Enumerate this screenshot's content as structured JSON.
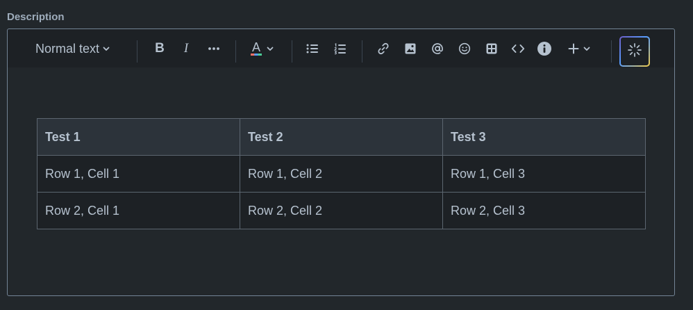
{
  "field": {
    "label": "Description"
  },
  "toolbar": {
    "text_style": "Normal text",
    "bold": "B",
    "italic": "I",
    "text_color": "A",
    "icons": {
      "text_style_chevron": "chevron-down-icon",
      "more_formatting": "more-icon",
      "bullet_list": "bullet-list-icon",
      "numbered_list": "numbered-list-icon",
      "link": "link-icon",
      "image": "image-icon",
      "mention": "mention-icon",
      "emoji": "emoji-icon",
      "table": "table-icon",
      "code": "code-icon",
      "info": "info-icon",
      "insert": "plus-icon",
      "ai": "ai-sparkle-icon"
    }
  },
  "table": {
    "headers": [
      "Test 1",
      "Test 2",
      "Test 3"
    ],
    "rows": [
      [
        "Row 1, Cell 1",
        "Row 1, Cell 2",
        "Row 1, Cell 3"
      ],
      [
        "Row 2, Cell 1",
        "Row 2, Cell 2",
        "Row 2, Cell 3"
      ]
    ]
  },
  "colors": {
    "background": "#22272b",
    "toolbar": "#1d2125",
    "text": "#b6c2cf",
    "label": "#9fadbc",
    "border": "#738496",
    "header_cell": "#2c333a",
    "text_color_bar": [
      "#f87168",
      "#579dff",
      "#4bce97"
    ]
  }
}
